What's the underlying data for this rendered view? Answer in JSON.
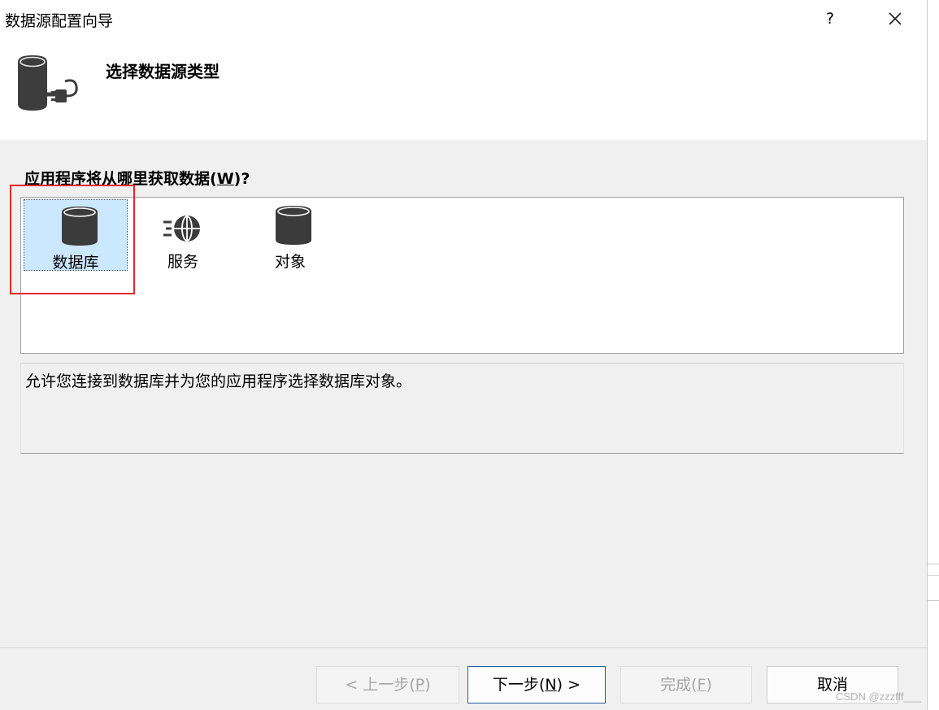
{
  "window": {
    "title": "数据源配置向导",
    "help_label": "?"
  },
  "header": {
    "title": "选择数据源类型",
    "icon": "database-plug-icon"
  },
  "question": {
    "text": "应用程序将从哪里获取数据(",
    "mnemonic": "W",
    "suffix": ")?"
  },
  "sources": [
    {
      "label": "数据库",
      "icon": "database-icon",
      "selected": true
    },
    {
      "label": "服务",
      "icon": "globe-service-icon",
      "selected": false
    },
    {
      "label": "对象",
      "icon": "object-cylinder-icon",
      "selected": false
    }
  ],
  "description": "允许您连接到数据库并为您的应用程序选择数据库对象。",
  "buttons": {
    "back": {
      "prefix": "< 上一步(",
      "key": "P",
      "suffix": ")",
      "enabled": false
    },
    "next": {
      "prefix": "下一步(",
      "key": "N",
      "suffix": ") >",
      "enabled": true
    },
    "finish": {
      "prefix": "完成(",
      "key": "F",
      "suffix": ")",
      "enabled": false
    },
    "cancel": {
      "label": "取消",
      "enabled": true
    }
  },
  "watermark": "CSDN @zzzfff___",
  "colors": {
    "selection_bg": "#cce8ff",
    "highlight_border": "#e02828",
    "icon_dark": "#3b3b3b",
    "primary_border": "#1e5ea8"
  }
}
